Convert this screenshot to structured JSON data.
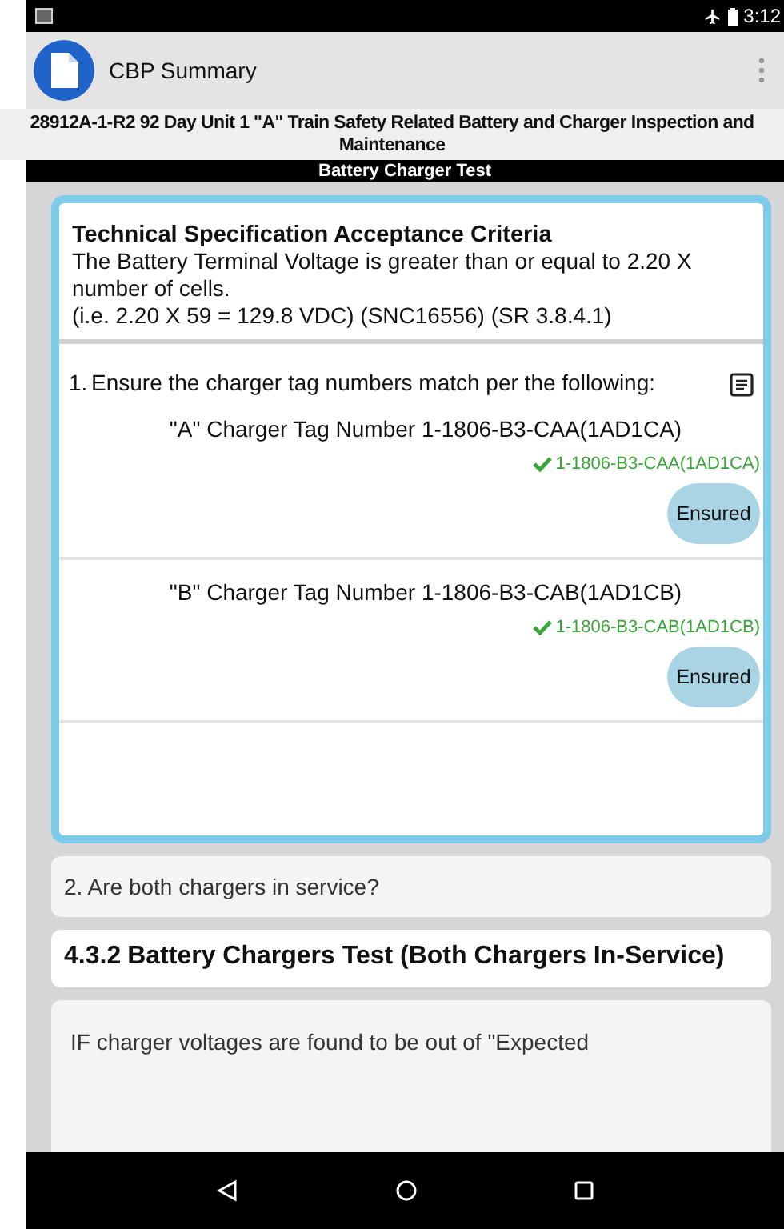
{
  "status_bar": {
    "time": "3:12"
  },
  "app_bar": {
    "title": "CBP Summary"
  },
  "procedure_title": "28912A-1-R2 92 Day Unit 1 \"A\" Train Safety Related Battery and Charger Inspection and Maintenance",
  "section_bar": "Battery Charger Test",
  "criteria": {
    "heading": "Technical Specification Acceptance Criteria",
    "lines": [
      "The Battery Terminal Voltage is greater than or equal to 2.20 X number of cells.",
      "(i.e. 2.20 X 59 = 129.8 VDC) (SNC16556) (SR 3.8.4.1)"
    ]
  },
  "step_1": {
    "number": "1.",
    "text": "Ensure the charger tag numbers match per the following:",
    "checks": [
      {
        "label": "\"A\" Charger Tag Number 1-1806-B3-CAA(1AD1CA)",
        "verified": true,
        "value": "1-1806-B3-CAA(1AD1CA)",
        "button": "Ensured"
      },
      {
        "label": "\"B\" Charger Tag Number 1-1806-B3-CAB(1AD1CB)",
        "verified": true,
        "value": "1-1806-B3-CAB(1AD1CB)",
        "button": "Ensured"
      }
    ]
  },
  "step_2": "2. Are both chargers in service?",
  "section_heading": {
    "number": "4.3.2",
    "title": "Battery Chargers Test (Both Chargers In-Service)"
  },
  "note": "IF charger voltages are found to be out of \"Expected"
}
